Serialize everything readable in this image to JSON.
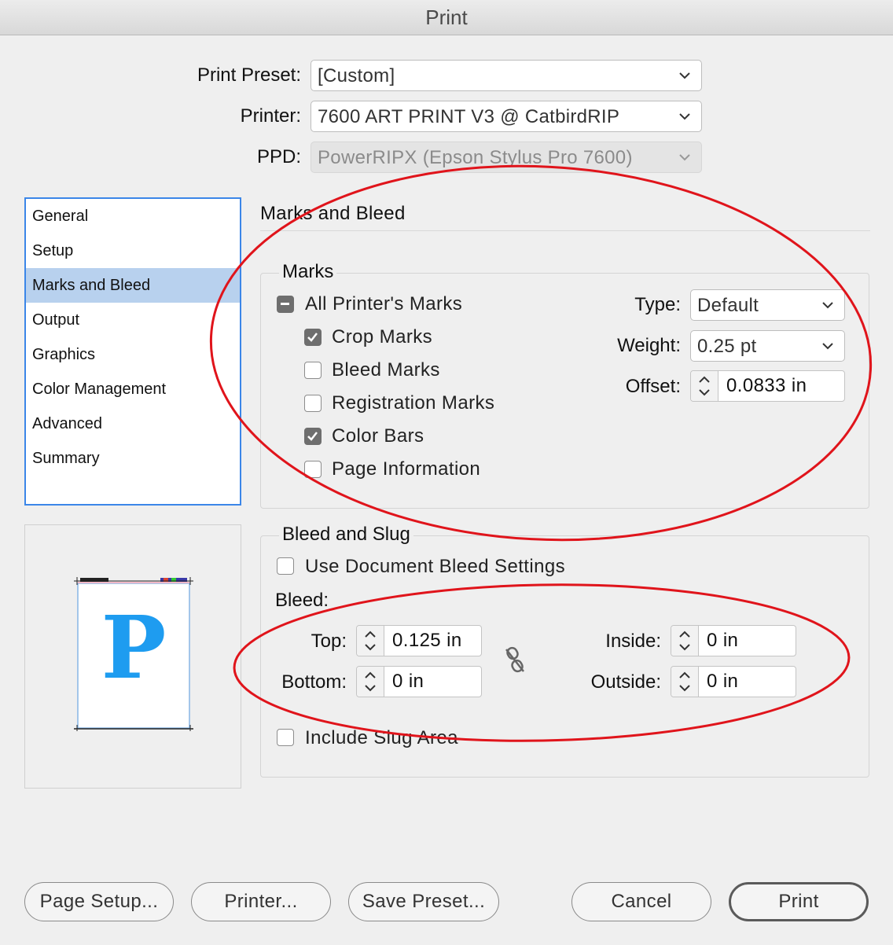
{
  "window": {
    "title": "Print"
  },
  "presets": {
    "print_preset_label": "Print Preset:",
    "print_preset_value": "[Custom]",
    "printer_label": "Printer:",
    "printer_value": "7600 ART PRINT V3 @ CatbirdRIP",
    "ppd_label": "PPD:",
    "ppd_value": "PowerRIPX (Epson Stylus Pro 7600)"
  },
  "sidebar": {
    "items": [
      {
        "label": "General"
      },
      {
        "label": "Setup"
      },
      {
        "label": "Marks and Bleed"
      },
      {
        "label": "Output"
      },
      {
        "label": "Graphics"
      },
      {
        "label": "Color Management"
      },
      {
        "label": "Advanced"
      },
      {
        "label": "Summary"
      }
    ],
    "selected": "Marks and Bleed"
  },
  "preview": {
    "glyph": "P",
    "accent": "#1e9cf0"
  },
  "panel": {
    "title": "Marks and Bleed"
  },
  "marks": {
    "title": "Marks",
    "all_marks": {
      "label": "All Printer's Marks",
      "state": "mixed"
    },
    "items": [
      {
        "label": "Crop Marks",
        "checked": true
      },
      {
        "label": "Bleed Marks",
        "checked": false
      },
      {
        "label": "Registration Marks",
        "checked": false
      },
      {
        "label": "Color Bars",
        "checked": true
      },
      {
        "label": "Page Information",
        "checked": false
      }
    ],
    "type_label": "Type:",
    "type_value": "Default",
    "weight_label": "Weight:",
    "weight_value": "0.25 pt",
    "offset_label": "Offset:",
    "offset_value": "0.0833 in"
  },
  "bleed": {
    "title": "Bleed and Slug",
    "use_doc": {
      "label": "Use Document Bleed Settings",
      "checked": false
    },
    "bleed_label": "Bleed:",
    "top_label": "Top:",
    "top_value": "0.125 in",
    "bottom_label": "Bottom:",
    "bottom_value": "0 in",
    "inside_label": "Inside:",
    "inside_value": "0 in",
    "outside_label": "Outside:",
    "outside_value": "0 in",
    "include_slug": {
      "label": "Include Slug Area",
      "checked": false
    }
  },
  "buttons": {
    "page_setup": "Page Setup...",
    "printer": "Printer...",
    "save_preset": "Save Preset...",
    "cancel": "Cancel",
    "print": "Print"
  },
  "colors": {
    "annotation": "#e0141b",
    "selection": "#b8d1ee",
    "focus": "#3b86e8"
  }
}
